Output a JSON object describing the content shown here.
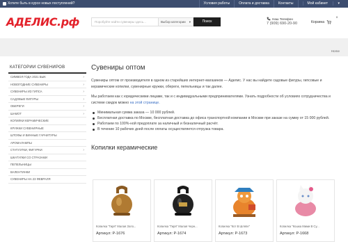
{
  "topbar": {
    "notice": "Хотите быть в курсе новых поступлений?",
    "links": [
      "Условия работы",
      "Оплата и доставка",
      "Контакты",
      "Мой кабинет"
    ]
  },
  "header": {
    "logo": "АДЕЛИС.рф",
    "search_placeholder": "Поробуйте найти сувениры здесь...",
    "category_select": "Выбор категории",
    "search_button": "Поиск",
    "phone_label": "Наш Телефон",
    "phone_number": "7 (909) 690-20-90",
    "cart_label": "Корзина",
    "cart_count": "0"
  },
  "breadcrumb": "Home",
  "sidebar": {
    "title": "КАТЕГОРИИ СУВЕНИРОВ",
    "items": [
      {
        "label": "СИМВОЛ ГОДА 2021 БЫК",
        "arrow": true
      },
      {
        "label": "НОВОГОДНИЕ СУВЕНИРЫ",
        "arrow": true
      },
      {
        "label": "СУВЕНИРЫ ИЗ ГИПСА",
        "arrow": true
      },
      {
        "label": "САДОВЫЕ ФИГУРЫ",
        "arrow": true
      },
      {
        "label": "ОБЕРЕГИ",
        "arrow": true
      },
      {
        "label": "ШАМОТ",
        "arrow": true
      },
      {
        "label": "КОПИЛКИ КЕРАМИЧЕСКИЕ",
        "arrow": false
      },
      {
        "label": "КРУЖКИ СУВЕНИРНЫЕ",
        "arrow": false
      },
      {
        "label": "ШТОФЫ И ВИННЫЕ ГАРНИТУРЫ",
        "arrow": false
      },
      {
        "label": "АРОМАЛАМПЫ",
        "arrow": false
      },
      {
        "label": "СТАТУЭТКИ, ФИГУРКИ",
        "arrow": true
      },
      {
        "label": "ШКАТУЛКИ СО СТРАЗАМИ",
        "arrow": false
      },
      {
        "label": "ПЕПЕЛЬНИЦЫ",
        "arrow": false
      },
      {
        "label": "ВАЛЕНТИНКИ",
        "arrow": false
      },
      {
        "label": "СУВЕНИРЫ НА 23 ФЕВРАЛЯ",
        "arrow": false
      }
    ]
  },
  "main": {
    "title": "Сувениры оптом",
    "p1": "Сувениры оптом от производителя в одном из старейших интернет-магазинов — Аделис. У нас вы найдете садовые фигуры, гипсовые и керамические копилки, сувенирные кружки, обереги, пепельницы и так далее.",
    "p2_text": "Мы работаем как с юридическими лицами, так и с индивидуальными предпринимателями. Узнать подробности об условиях сотрудничества и системе скидок можно ",
    "p2_link": "на этой странице.",
    "bullets": [
      "Минимальная сумма заказа —  10 000 рублей.",
      "Бесплатная доставка по Москве, бесплатная доставка до офиса транспортной компании в Москве при заказе на сумму от 15 000 рублей.",
      "Работаем по 100%-ной предоплате за наличный и безналичный расчёт.",
      "В течение 10 рабочих дней после оплаты осуществляется отгрузка товара."
    ],
    "section_title": "Копилки керамические"
  },
  "products": [
    {
      "name": "Копилка \"Гиря\" Малая Золо...",
      "sku": "Артикул: Р-1676"
    },
    {
      "name": "Копилка \"Гиря\" Малая Черн...",
      "sku": "Артикул: Р-1674"
    },
    {
      "name": "Копилка \"Кот В Шляпе\"",
      "sku": "Артикул: Р-1673"
    },
    {
      "name": "Копилка \"Кошка Мими В Су...",
      "sku": "Артикул: Р-1668"
    }
  ],
  "colors": {
    "topbar": "#3c4d6f",
    "logo": "#e3222b",
    "link": "#3a6fc4"
  }
}
